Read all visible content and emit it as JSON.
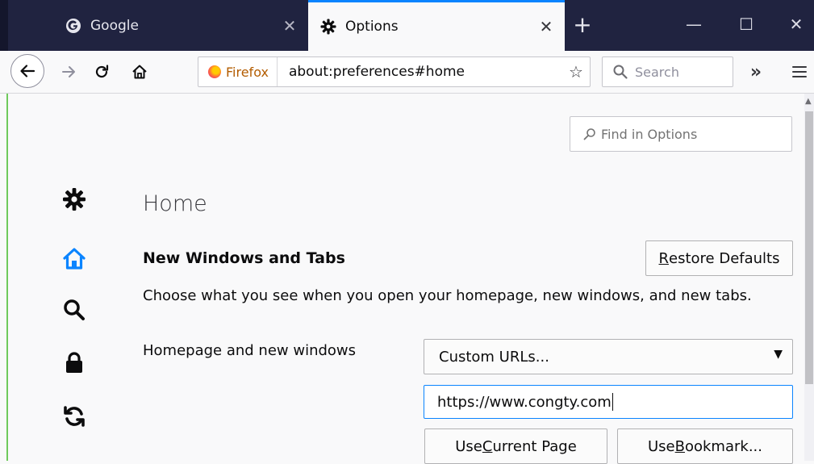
{
  "tabs": [
    {
      "label": "Google",
      "icon": "google-g-icon",
      "active": false
    },
    {
      "label": "Options",
      "icon": "gear-icon",
      "active": true
    }
  ],
  "toolbar": {
    "identity_label": "Firefox",
    "url": "about:preferences#home",
    "search_placeholder": "Search"
  },
  "find": {
    "placeholder": "Find in Options"
  },
  "categories": [
    {
      "icon": "gear-icon",
      "name": "General",
      "selected": false
    },
    {
      "icon": "home-icon",
      "name": "Home",
      "selected": true
    },
    {
      "icon": "search-icon",
      "name": "Search",
      "selected": false
    },
    {
      "icon": "lock-icon",
      "name": "Privacy & Security",
      "selected": false
    },
    {
      "icon": "sync-icon",
      "name": "Sync",
      "selected": false
    }
  ],
  "main": {
    "page_title": "Home",
    "section_title": "New Windows and Tabs",
    "restore_button": {
      "accesskey": "R",
      "rest": "estore Defaults"
    },
    "description": "Choose what you see when you open your homepage, new windows, and new tabs.",
    "homepage_label": "Homepage and new windows",
    "homepage_select_value": "Custom URLs...",
    "homepage_url": "https://www.congty.com",
    "use_current_page": {
      "before": "Use ",
      "accesskey": "C",
      "after": "urrent Page"
    },
    "use_bookmark": {
      "before": "Use ",
      "accesskey": "B",
      "after": "ookmark..."
    }
  },
  "colors": {
    "tabbar_bg": "#202340",
    "accent": "#0a84ff",
    "selected_category": "#0a84ff",
    "content_bg": "#f9f9fa"
  }
}
